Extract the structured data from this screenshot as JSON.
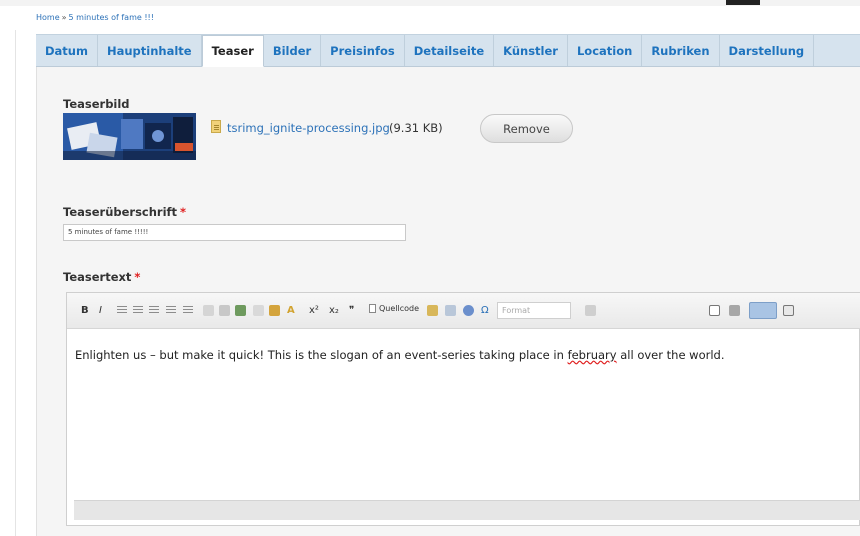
{
  "breadcrumb": {
    "home": "Home",
    "separator": "»",
    "current": "5 minutes of fame !!!"
  },
  "tabs": [
    {
      "label": "Datum",
      "active": false
    },
    {
      "label": "Hauptinhalte",
      "active": false
    },
    {
      "label": "Teaser",
      "active": true
    },
    {
      "label": "Bilder",
      "active": false
    },
    {
      "label": "Preisinfos",
      "active": false
    },
    {
      "label": "Detailseite",
      "active": false
    },
    {
      "label": "Künstler",
      "active": false
    },
    {
      "label": "Location",
      "active": false
    },
    {
      "label": "Rubriken",
      "active": false
    },
    {
      "label": "Darstellung",
      "active": false
    }
  ],
  "teaserbild": {
    "label": "Teaserbild",
    "file_name": "tsrimg_ignite-processing.jpg",
    "file_size": "(9.31 KB)",
    "remove_label": "Remove",
    "file_icon": "image-file-icon"
  },
  "teaserueberschrift": {
    "label": "Teaserüberschrift",
    "required_mark": "*",
    "value": "5 minutes of fame !!!!!"
  },
  "teasertext": {
    "label": "Teasertext",
    "required_mark": "*",
    "toolbar": {
      "bold": "B",
      "italic": "I",
      "quelltext": "Quellcode",
      "format_placeholder": "Format",
      "superscript": "x²",
      "subscript": "x₂",
      "quote": "❞",
      "omega": "Ω",
      "text_color": "A"
    },
    "content_before": "Enlighten us – but make it quick! This is the slogan of an event-series taking place in ",
    "content_misspelled": "february",
    "content_after": " all over the world."
  },
  "colors": {
    "link": "#2d72b8",
    "tabbar_bg": "#d6e3ee",
    "required": "#e02020",
    "panel_bg": "#f5f5f5"
  }
}
